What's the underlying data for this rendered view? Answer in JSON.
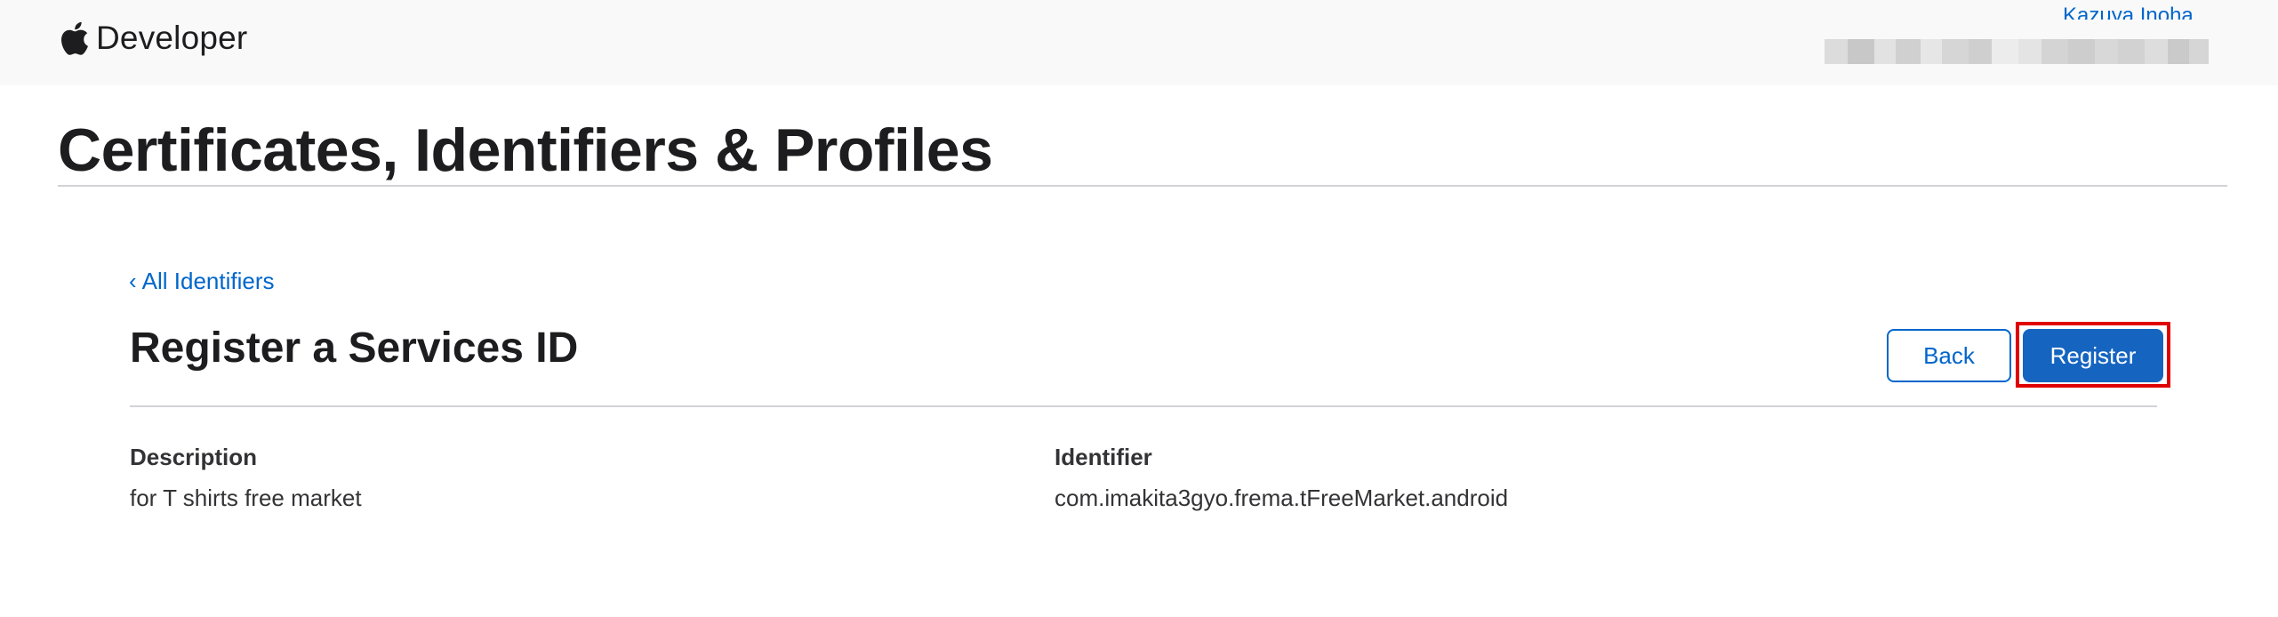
{
  "header": {
    "logo_text": "Developer",
    "account_name": "Kazuya Inoha",
    "accent_color": "#0066cc"
  },
  "page": {
    "title": "Certificates, Identifiers & Profiles"
  },
  "nav": {
    "back_link_chevron": "‹",
    "back_link_label": "All Identifiers"
  },
  "section": {
    "title": "Register a Services ID",
    "back_button_label": "Back",
    "register_button_label": "Register",
    "register_button_color": "#1565c0",
    "highlight_color": "#e00000"
  },
  "fields": {
    "description_label": "Description",
    "description_value": "for T shirts free market",
    "identifier_label": "Identifier",
    "identifier_value": "com.imakita3gyo.frema.tFreeMarket.android"
  }
}
